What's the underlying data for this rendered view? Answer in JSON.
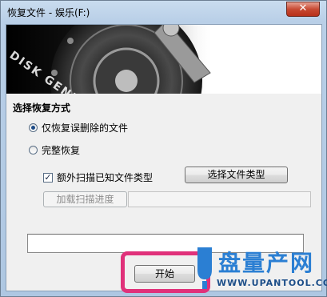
{
  "window": {
    "title": "恢复文件 - 娱乐(F:)",
    "close_label": "✕"
  },
  "banner": {
    "brand": "DISK GENIUS"
  },
  "recovery": {
    "section_title": "选择恢复方式",
    "options": [
      {
        "label": "仅恢复误删除的文件",
        "checked": true
      },
      {
        "label": "完整恢复",
        "checked": false
      }
    ],
    "scan_known_types": {
      "label": "额外扫描已知文件类型",
      "checked": true
    },
    "select_types_button": "选择文件类型",
    "load_progress_button": "加载扫描进度",
    "load_progress_path": "",
    "status_text": "",
    "start_button": "开始"
  },
  "watermark": {
    "title": "盘量产网",
    "url": "WWW.UPANTOOL.COM"
  },
  "colors": {
    "highlight": "#e0317a",
    "watermark_blue": "#2b7fd3"
  }
}
